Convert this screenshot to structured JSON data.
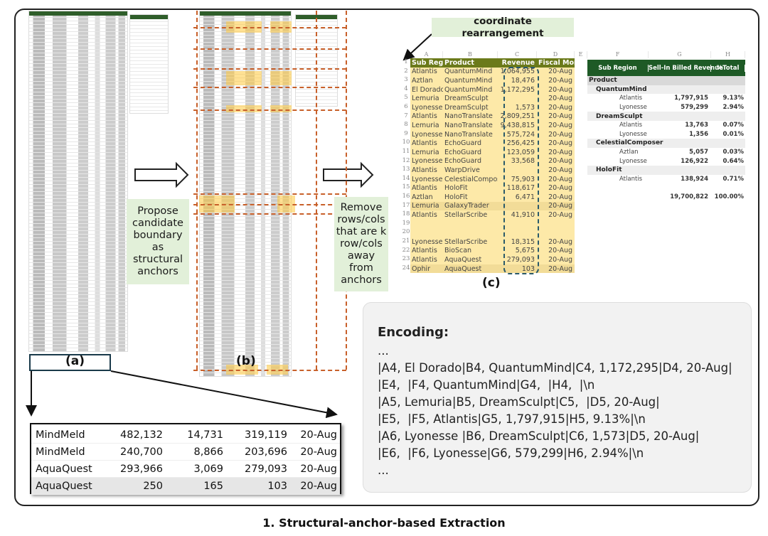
{
  "caption": "1. Structural-anchor-based Extraction",
  "panel_labels": {
    "a": "(a)",
    "b": "(b)",
    "c": "(c)"
  },
  "step_boxes": {
    "propose": "Propose candidate boundary as structural anchors",
    "remove": "Remove rows/cols that are k row/cols away from anchors",
    "rearrange": "coordinate rearrangement"
  },
  "colors": {
    "highlight": "#fde9a8",
    "anchor_line": "#c8602a",
    "step_box": "#e2f0d9",
    "header_green": "#1e5a26"
  },
  "zoom_table": {
    "rows": [
      [
        "MindMeld",
        "482,132",
        "14,731",
        "319,119",
        "20-Aug"
      ],
      [
        "MindMeld",
        "240,700",
        "8,866",
        "203,696",
        "20-Aug"
      ],
      [
        "AquaQuest",
        "293,966",
        "3,069",
        "279,093",
        "20-Aug"
      ],
      [
        "AquaQuest",
        "250",
        "165",
        "103",
        "20-Aug"
      ]
    ]
  },
  "sheet": {
    "columns": [
      "A",
      "B",
      "C",
      "D",
      "E",
      "F",
      "G",
      "H"
    ],
    "left_table": {
      "header": [
        "Sub Region",
        "Product",
        "Revenue",
        "Fiscal Month"
      ],
      "rows": [
        [
          "2",
          "Atlantis",
          "QuantumMind",
          "1,064,955",
          "20-Aug"
        ],
        [
          "3",
          "Aztlan",
          "QuantumMind",
          "18,476",
          "20-Aug"
        ],
        [
          "4",
          "El Dorado",
          "QuantumMind",
          "1,172,295",
          "20-Aug"
        ],
        [
          "5",
          "Lemuria",
          "DreamSculpt",
          "",
          "20-Aug"
        ],
        [
          "6",
          "Lyonesse",
          "DreamSculpt",
          "1,573",
          "20-Aug"
        ],
        [
          "7",
          "Atlantis",
          "NanoTranslate",
          "2,809,251",
          "20-Aug"
        ],
        [
          "8",
          "Lemuria",
          "NanoTranslate",
          "9,438,815",
          "20-Aug"
        ],
        [
          "9",
          "Lyonesse",
          "NanoTranslate",
          "575,724",
          "20-Aug"
        ],
        [
          "10",
          "Atlantis",
          "EchoGuard",
          "256,425",
          "20-Aug"
        ],
        [
          "11",
          "Lemuria",
          "EchoGuard",
          "123,059",
          "20-Aug"
        ],
        [
          "12",
          "Lyonesse",
          "EchoGuard",
          "33,568",
          "20-Aug"
        ],
        [
          "13",
          "Atlantis",
          "WarpDrive",
          "",
          "20-Aug"
        ],
        [
          "14",
          "Lyonesse",
          "CelestialComposer",
          "75,903",
          "20-Aug"
        ],
        [
          "15",
          "Atlantis",
          "HoloFit",
          "118,617",
          "20-Aug"
        ],
        [
          "16",
          "Aztlan",
          "HoloFit",
          "6,471",
          "20-Aug"
        ],
        [
          "17",
          "Lemuria",
          "GalaxyTrader",
          "",
          "20-Aug"
        ],
        [
          "18",
          "Atlantis",
          "StellarScribe",
          "41,910",
          "20-Aug"
        ],
        [
          "19",
          "",
          "",
          "",
          ""
        ],
        [
          "20",
          "",
          "",
          "",
          ""
        ],
        [
          "21",
          "Lyonesse",
          "StellarScribe",
          "18,315",
          "20-Aug"
        ],
        [
          "22",
          "Atlantis",
          "BioScan",
          "5,675",
          "20-Aug"
        ],
        [
          "23",
          "Atlantis",
          "AquaQuest",
          "279,093",
          "20-Aug"
        ],
        [
          "24",
          "Ophir",
          "AquaQuest",
          "103",
          "20-Aug"
        ]
      ]
    },
    "right_table": {
      "header": [
        "Sub Region",
        "Sell-In Billed Revenue",
        "%Total"
      ],
      "rows": [
        {
          "level": 0,
          "label": "Product",
          "value": "",
          "pct": ""
        },
        {
          "level": 1,
          "label": "QuantumMind",
          "value": "",
          "pct": ""
        },
        {
          "level": 2,
          "label": "Atlantis",
          "value": "1,797,915",
          "pct": "9.13%"
        },
        {
          "level": 2,
          "label": "Lyonesse",
          "value": "579,299",
          "pct": "2.94%"
        },
        {
          "level": 1,
          "label": "DreamSculpt",
          "value": "",
          "pct": ""
        },
        {
          "level": 2,
          "label": "Atlantis",
          "value": "13,763",
          "pct": "0.07%"
        },
        {
          "level": 2,
          "label": "Lyonesse",
          "value": "1,356",
          "pct": "0.01%"
        },
        {
          "level": 1,
          "label": "CelestialComposer",
          "value": "",
          "pct": ""
        },
        {
          "level": 2,
          "label": "Aztlan",
          "value": "5,057",
          "pct": "0.03%"
        },
        {
          "level": 2,
          "label": "Lyonesse",
          "value": "126,922",
          "pct": "0.64%"
        },
        {
          "level": 1,
          "label": "HoloFit",
          "value": "",
          "pct": ""
        },
        {
          "level": 2,
          "label": "Atlantis",
          "value": "138,924",
          "pct": "0.71%"
        },
        {
          "level": 3,
          "label": "",
          "value": "",
          "pct": ""
        },
        {
          "level": 3,
          "label": "",
          "value": "19,700,822",
          "pct": "100.00%"
        }
      ]
    }
  },
  "encoding": {
    "title": "Encoding:",
    "lines": [
      "...",
      "|A4, El Dorado|B4, QuantumMind|C4, 1,172,295|D4, 20-Aug|",
      "|E4,  |F4, QuantumMind|G4,  |H4,  |\\n",
      "|A5, Lemuria|B5, DreamSculpt|C5,  |D5, 20-Aug|",
      "|E5,  |F5, Atlantis|G5, 1,797,915|H5, 9.13%|\\n",
      "|A6, Lyonesse |B6, DreamSculpt|C6, 1,573|D5, 20-Aug|",
      "|E6,  |F6, Lyonesse|G6, 579,299|H6, 2.94%|\\n",
      "..."
    ]
  }
}
